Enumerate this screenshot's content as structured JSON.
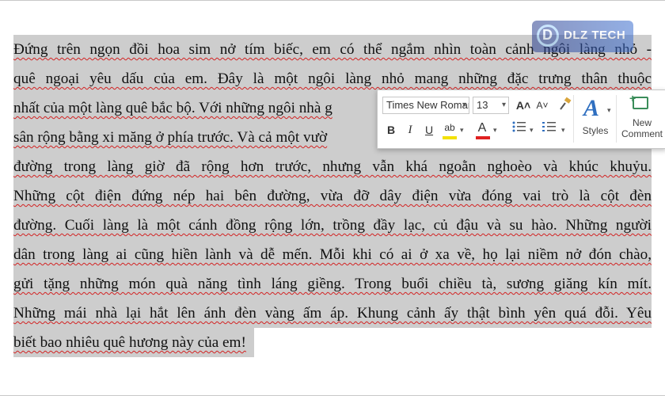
{
  "document": {
    "lines": [
      "Đứng trên ngọn đồi hoa sim nở tím biếc, em có thể ngắm nhìn toàn cảnh ngôi làng nhỏ -",
      "quê ngoại yêu dấu của em. Đây là một ngôi làng nhỏ mang những đặc trưng thân thuộc",
      "nhất của một làng quê bắc bộ. Với những ngôi nhà g",
      "sân rộng bằng xi măng ở phía trước. Và cả một vườ",
      "đường trong làng giờ đã rộng hơn trước, nhưng vẫn khá ngoằn nghoèo và khúc khuỷu.",
      "Những cột điện đứng nép hai bên đường, vừa đỡ dây điện vừa đóng vai trò là cột đèn",
      "đường. Cuối làng là một cánh đồng rộng lớn, trồng đầy lạc, củ đậu và su hào. Những người",
      "dân trong làng ai cũng hiền lành và dễ mến. Mỗi khi có ai ở xa về, họ lại niềm nở đón chào,",
      "gửi tặng những món quà năng tình láng giềng. Trong buổi chiều tà, sương giăng kín mít.",
      "Những mái nhà lại hắt lên ánh đèn vàng ấm áp. Khung cảnh ấy thật bình yên quá đỗi. Yêu",
      "biết bao nhiêu quê hương này của em!"
    ]
  },
  "watermark": {
    "brand": "DLZ TECH",
    "mark": "D"
  },
  "mini_toolbar": {
    "font_name": "Times New Roman",
    "font_size": "13",
    "grow_font": "A˄",
    "shrink_font": "A˅",
    "bold": "B",
    "italic": "I",
    "underline": "U",
    "highlight": "ab",
    "font_color": "A",
    "styles_label": "Styles",
    "new_comment_label": "New Comment",
    "highlight_color": "#f3e100",
    "font_color_value": "#e02020"
  },
  "colors": {
    "selection": "#cdcdcd",
    "spellcheck": "#d32222"
  }
}
